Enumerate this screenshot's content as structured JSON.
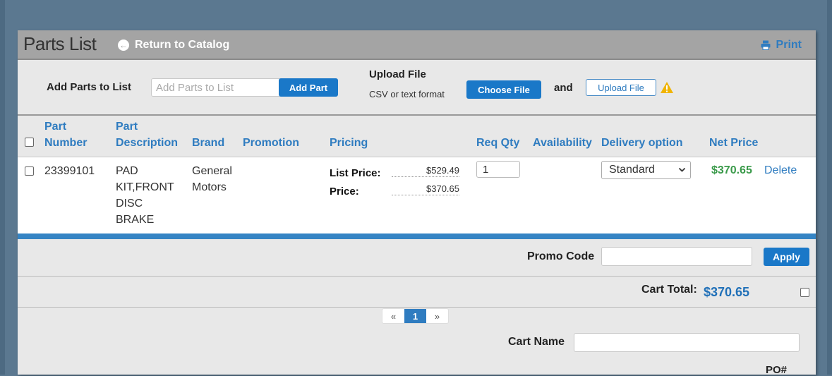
{
  "header": {
    "title": "Parts List",
    "return_label": "Return to Catalog",
    "print_label": "Print"
  },
  "add_parts": {
    "label": "Add Parts to List",
    "placeholder": "Add Parts to List",
    "button": "Add Part"
  },
  "upload": {
    "title": "Upload File",
    "subtitle": "CSV or text format",
    "choose_button": "Choose File",
    "and_text": "and",
    "upload_button": "Upload File"
  },
  "table": {
    "headers": {
      "part_number_1": "Part",
      "part_number_2": "Number",
      "part_description_1": "Part",
      "part_description_2": "Description",
      "brand": "Brand",
      "promotion": "Promotion",
      "pricing": "Pricing",
      "req_qty": "Req Qty",
      "availability": "Availability",
      "delivery_option": "Delivery option",
      "net_price": "Net Price"
    },
    "rows": [
      {
        "part_number": "23399101",
        "description_lines": [
          "PAD",
          "KIT,FRONT",
          "DISC",
          "BRAKE"
        ],
        "brand_lines": [
          "General",
          "Motors"
        ],
        "list_price_label": "List Price:",
        "list_price": "$529.49",
        "price_label": "Price:",
        "price": "$370.65",
        "qty": "1",
        "delivery": "Standard",
        "net_price": "$370.65",
        "delete_label": "Delete"
      }
    ]
  },
  "promo": {
    "label": "Promo Code",
    "apply_button": "Apply"
  },
  "cart_total": {
    "label": "Cart Total:",
    "value": "$370.65"
  },
  "pagination": {
    "prev": "«",
    "current": "1",
    "next": "»"
  },
  "cart_name": {
    "label": "Cart Name"
  },
  "po": {
    "label": "PO#"
  },
  "colors": {
    "accent": "#1a78c8",
    "link": "#2f7cc0",
    "net_price": "#3a9a4a",
    "warning": "#f0b400",
    "background": "#5b7890"
  }
}
